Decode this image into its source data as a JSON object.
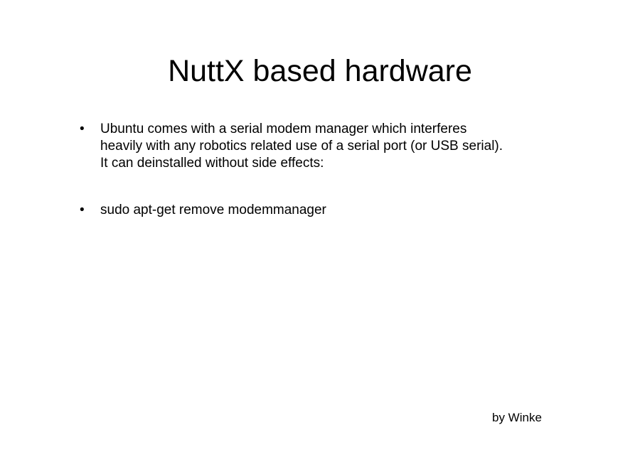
{
  "slide": {
    "title": "NuttX based hardware",
    "bullets": [
      {
        "marker": "•",
        "lines": [
          "Ubuntu comes with a serial modem manager which interferes",
          "heavily with any robotics related use of a serial port (or USB serial).",
          "It can deinstalled without side effects:"
        ]
      },
      {
        "marker": "•",
        "lines": [
          "sudo apt-get remove modemmanager"
        ]
      }
    ],
    "footer": "by Winke"
  }
}
